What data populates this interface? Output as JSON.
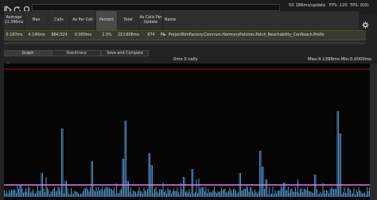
{
  "toolbar": {
    "icons": [
      "play-icon",
      "refresh-icon",
      "search-icon"
    ],
    "search_value": "",
    "stats": "5X 186ms/update",
    "fps": "FPS: 120",
    "tps": "TPS: 0(0)"
  },
  "table": {
    "headers": [
      "Average\n11.396ms",
      "Max",
      "Calls",
      "Av Per Call",
      "Percent",
      "Total",
      "Av Calls Per\nUpdate",
      "Name"
    ],
    "selected_header": "Percent",
    "row": {
      "average": "0.187ms",
      "max": "4.140ms",
      "calls": "864,524",
      "av_per_call": "0.000ms",
      "percent": "1.5%",
      "total": "213.806ms",
      "av_calls_per_update": "674",
      "marker": "M▸",
      "name": "ProjectRimFactory.Common.HarmonyPatches.Patch_Reachability_CanReach.Prefix"
    }
  },
  "tabs": [
    "Graph",
    "Stacktrace",
    "Save and Compare"
  ],
  "active_tab": "Graph",
  "graph": {
    "title": "0ms 0 calls",
    "stats": "Max:4.1399ms Min:0.0000ms",
    "colors": {
      "bars": "#4f8fc4",
      "limit_line": "#9b1c1c",
      "average_line": "#e079e8",
      "background": "#050505"
    }
  }
}
